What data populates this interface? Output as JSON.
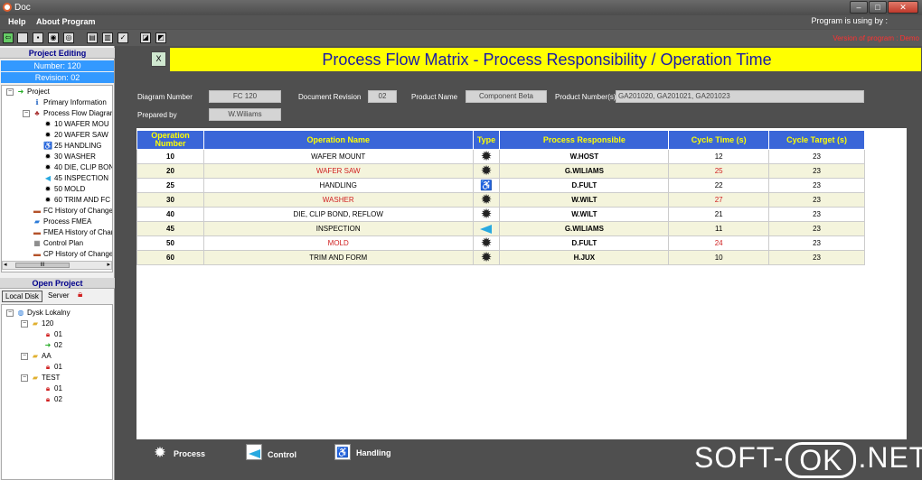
{
  "window": {
    "title": "Doc"
  },
  "menu": {
    "items": [
      "Help",
      "About Program"
    ]
  },
  "status": {
    "program_using": "Program is using by :",
    "version": "Version of program : Demo"
  },
  "left": {
    "project_header": "Project Editing",
    "number": "Number: 120",
    "revision": "Revision: 02",
    "tree": [
      "Project",
      "Primary Information",
      "Process Flow Diagran",
      "10 WAFER MOU",
      "20 WAFER SAW",
      "25 HANDLING",
      "30 WASHER",
      "40 DIE, CLIP BON",
      "45 INSPECTION",
      "50 MOLD",
      "60 TRIM AND FC",
      "FC History of Change",
      "Process FMEA",
      "FMEA History of Char",
      "Control Plan",
      "CP History of Change"
    ],
    "open_header": "Open Project",
    "tab_local": "Local Disk",
    "tab_server": "Server",
    "disk_tree": [
      "Dysk Lokalny",
      "120",
      "01",
      "02",
      "AA",
      "01",
      "TEST",
      "01",
      "02"
    ],
    "scroll_glyph": "III"
  },
  "main": {
    "title": "Process Flow Matrix - Process Responsibility / Operation Time",
    "form": {
      "diagram_number_label": "Diagram Number",
      "diagram_number": "FC 120",
      "doc_revision_label": "Document Revision",
      "doc_revision": "02",
      "product_name_label": "Product Name",
      "product_name": "Component Beta",
      "product_numbers_label": "Product Number(s)",
      "product_numbers": "GA201020, GA201021, GA201023",
      "prepared_by_label": "Prepared by",
      "prepared_by": "W.Wiliams"
    },
    "columns": [
      "Operation Number",
      "Operation Name",
      "Type",
      "Process Responsible",
      "Cycle Time (s)",
      "Cycle Target (s)"
    ],
    "rows": [
      {
        "num": "10",
        "name": "WAFER MOUNT",
        "type": "process",
        "resp": "W.HOST",
        "cycle": "12",
        "target": "23",
        "red": false
      },
      {
        "num": "20",
        "name": "WAFER SAW",
        "type": "process",
        "resp": "G.WILIAMS",
        "cycle": "25",
        "target": "23",
        "red": true
      },
      {
        "num": "25",
        "name": "HANDLING",
        "type": "handling",
        "resp": "D.FULT",
        "cycle": "22",
        "target": "23",
        "red": false
      },
      {
        "num": "30",
        "name": "WASHER",
        "type": "process",
        "resp": "W.WILT",
        "cycle": "27",
        "target": "23",
        "red": true
      },
      {
        "num": "40",
        "name": "DIE, CLIP BOND, REFLOW",
        "type": "process",
        "resp": "W.WILT",
        "cycle": "21",
        "target": "23",
        "red": false
      },
      {
        "num": "45",
        "name": "INSPECTION",
        "type": "control",
        "resp": "G.WILIAMS",
        "cycle": "11",
        "target": "23",
        "red": false
      },
      {
        "num": "50",
        "name": "MOLD",
        "type": "process",
        "resp": "D.FULT",
        "cycle": "24",
        "target": "23",
        "red": true
      },
      {
        "num": "60",
        "name": "TRIM AND FORM",
        "type": "process",
        "resp": "H.JUX",
        "cycle": "10",
        "target": "23",
        "red": false
      }
    ],
    "legend": {
      "process": "Process",
      "control": "Control",
      "handling": "Handling"
    }
  },
  "watermark": {
    "left": "SOFT-",
    "ok": "OK",
    "right": ".NET"
  },
  "colors": {
    "accent": "#3a66d8",
    "title_band": "#ffff00",
    "over_target": "#d02020",
    "panel_blue": "#3399ff"
  }
}
